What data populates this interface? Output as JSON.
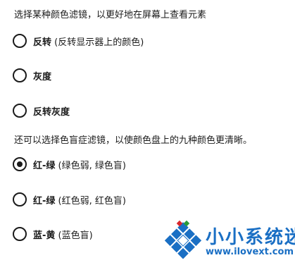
{
  "heading_filters": "选择某种颜色滤镜，以更好地在屏幕上查看元素",
  "filters": [
    {
      "main": "反转",
      "detail": " (反转显示器上的颜色)",
      "selected": false
    },
    {
      "main": "灰度",
      "detail": "",
      "selected": false
    },
    {
      "main": "反转灰度",
      "detail": "",
      "selected": false
    }
  ],
  "heading_colorblind": "还可以选择色盲症滤镜，以使颜色盘上的九种颜色更清晰。",
  "colorblind_filters": [
    {
      "main": "红-绿",
      "detail": " (绿色弱, 绿色盲)",
      "selected": true
    },
    {
      "main": "红-绿",
      "detail": " (红色弱, 红色盲)",
      "selected": false
    },
    {
      "main": "蓝-黄",
      "detail": " (蓝色盲)",
      "selected": false
    }
  ],
  "watermark": {
    "title": "小小系统迷",
    "url": "www.ilovext.com",
    "color": "#1a6fc4"
  },
  "colors": {
    "text": "#1a1a1a",
    "background": "#ffffff",
    "watermark_blue": "#1a6fc4",
    "watermark_red": "#d9262c",
    "watermark_green": "#2a9a3a"
  }
}
